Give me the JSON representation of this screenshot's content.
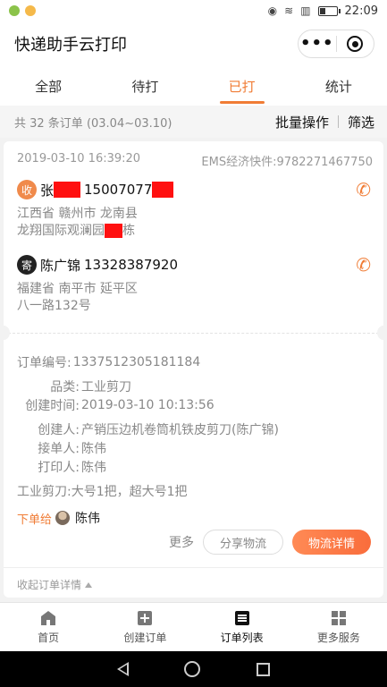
{
  "status_bar": {
    "time": "22:09"
  },
  "nav": {
    "title": "快递助手云打印",
    "more_icon": "ellipsis-icon",
    "close_icon": "target-icon"
  },
  "tabs": [
    {
      "label": "全部",
      "active": false
    },
    {
      "label": "待打",
      "active": false
    },
    {
      "label": "已打",
      "active": true
    },
    {
      "label": "统计",
      "active": false
    }
  ],
  "summary": {
    "text": "共 32 条订单 (03.04~03.10)",
    "batch_label": "批量操作",
    "filter_label": "筛选"
  },
  "order": {
    "datetime": "2019-03-10 16:39:20",
    "carrier": "EMS经济快件:9782271467750",
    "receiver": {
      "badge": "收",
      "name": "张",
      "phone": "15007077",
      "addr_line1": "江西省 赣州市 龙南县",
      "addr_line2a": "龙翔国际观澜园",
      "addr_line2b": "栋"
    },
    "sender": {
      "badge": "寄",
      "name": "陈广锦",
      "phone": "13328387920",
      "addr_line1": "福建省 南平市 延平区",
      "addr_line2": "八一路132号"
    },
    "details": {
      "order_no_label": "订单编号:",
      "order_no": "1337512305181184",
      "category_label": "品类:",
      "category": "工业剪刀",
      "created_label": "创建时间:",
      "created": "2019-03-10 10:13:56",
      "creator_label": "创建人:",
      "creator": "产销压边机卷筒机铁皮剪刀(陈广锦)",
      "receiver_label": "接单人:",
      "receiver_person": "陈伟",
      "printer_label": "打印人:",
      "printer": "陈伟",
      "items": "工业剪刀:大号1把，超大号1把",
      "dispatch_label": "下单给",
      "dispatch_name": "陈伟"
    },
    "actions": {
      "more": "更多",
      "share": "分享物流",
      "detail": "物流详情"
    },
    "collapse": "收起订单详情"
  },
  "tabbar": [
    {
      "label": "首页",
      "icon": "home-icon"
    },
    {
      "label": "创建订单",
      "icon": "plus-square-icon"
    },
    {
      "label": "订单列表",
      "icon": "list-icon",
      "active": true
    },
    {
      "label": "更多服务",
      "icon": "grid-icon"
    }
  ],
  "colors": {
    "accent": "#f07c35",
    "redaction": "#ff1010"
  }
}
